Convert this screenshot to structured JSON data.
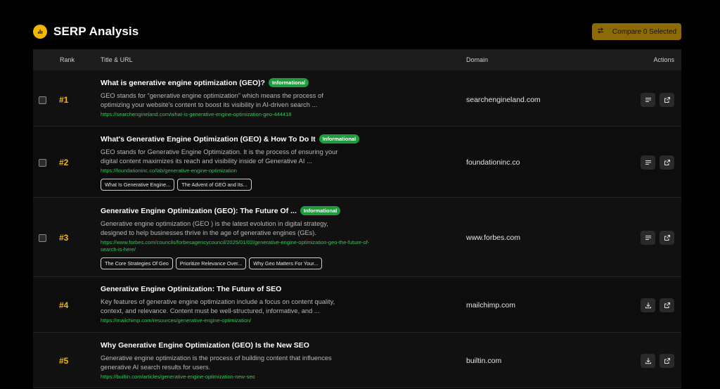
{
  "header": {
    "title": "SERP Analysis",
    "compare_label": "Compare 0 Selected"
  },
  "columns": {
    "rank": "Rank",
    "title_url": "Title & URL",
    "domain": "Domain",
    "actions": "Actions"
  },
  "rows": [
    {
      "rank": "#1",
      "title": "What is generative engine optimization (GEO)?",
      "badge": "Informational",
      "snippet": "GEO stands for “generative engine optimization” which means the process of optimizing your website's content to boost its visibility in AI-driven search ...",
      "url": "https://searchengineland.com/what-is-generative-engine-optimization-geo-444418",
      "chips": [],
      "domain": "searchengineland.com",
      "actions": [
        "list-icon",
        "external-link-icon"
      ]
    },
    {
      "rank": "#2",
      "title": "What's Generative Engine Optimization (GEO) & How To Do It",
      "badge": "Informational",
      "snippet": "GEO stands for Generative Engine Optimization. It is the process of ensuring your digital content maximizes its reach and visibility inside of Generative AI ...",
      "url": "https://foundationinc.co/lab/generative-engine-optimization",
      "chips": [
        "What Is Generative Engine...",
        "The Advent of GEO and Its..."
      ],
      "domain": "foundationinc.co",
      "actions": [
        "list-icon",
        "external-link-icon"
      ]
    },
    {
      "rank": "#3",
      "title": "Generative Engine Optimization (GEO): The Future Of ...",
      "badge": "Informational",
      "snippet": "Generative engine optimization (GEO ) is the latest evolution in digital strategy, designed to help businesses thrive in the age of generative engines (GEs).",
      "url": "https://www.forbes.com/councils/forbesagencycouncil/2025/01/02/generative-engine-optimization-geo-the-future-of-search-is-here/",
      "chips": [
        "The Core Strategies Of Geo",
        "Prioritize Relevance Over...",
        "Why Geo Matters For Your..."
      ],
      "domain": "www.forbes.com",
      "actions": [
        "list-icon",
        "external-link-icon"
      ]
    },
    {
      "rank": "#4",
      "title": "Generative Engine Optimization: The Future of SEO",
      "badge": "",
      "snippet": "Key features of generative engine optimization include a focus on content quality, context, and relevance. Content must be well-structured, informative, and ...",
      "url": "https://mailchimp.com/resources/generative-engine-optimization/",
      "chips": [],
      "domain": "mailchimp.com",
      "actions": [
        "download-icon",
        "external-link-icon"
      ]
    },
    {
      "rank": "#5",
      "title": "Why Generative Engine Optimization (GEO) Is the New SEO",
      "badge": "",
      "snippet": "Generative engine optimization is the process of building content that influences generative AI search results for users.",
      "url": "https://builtin.com/articles/generative-engine-optimization-new-seo",
      "chips": [],
      "domain": "builtin.com",
      "actions": [
        "download-icon",
        "external-link-icon"
      ]
    }
  ]
}
